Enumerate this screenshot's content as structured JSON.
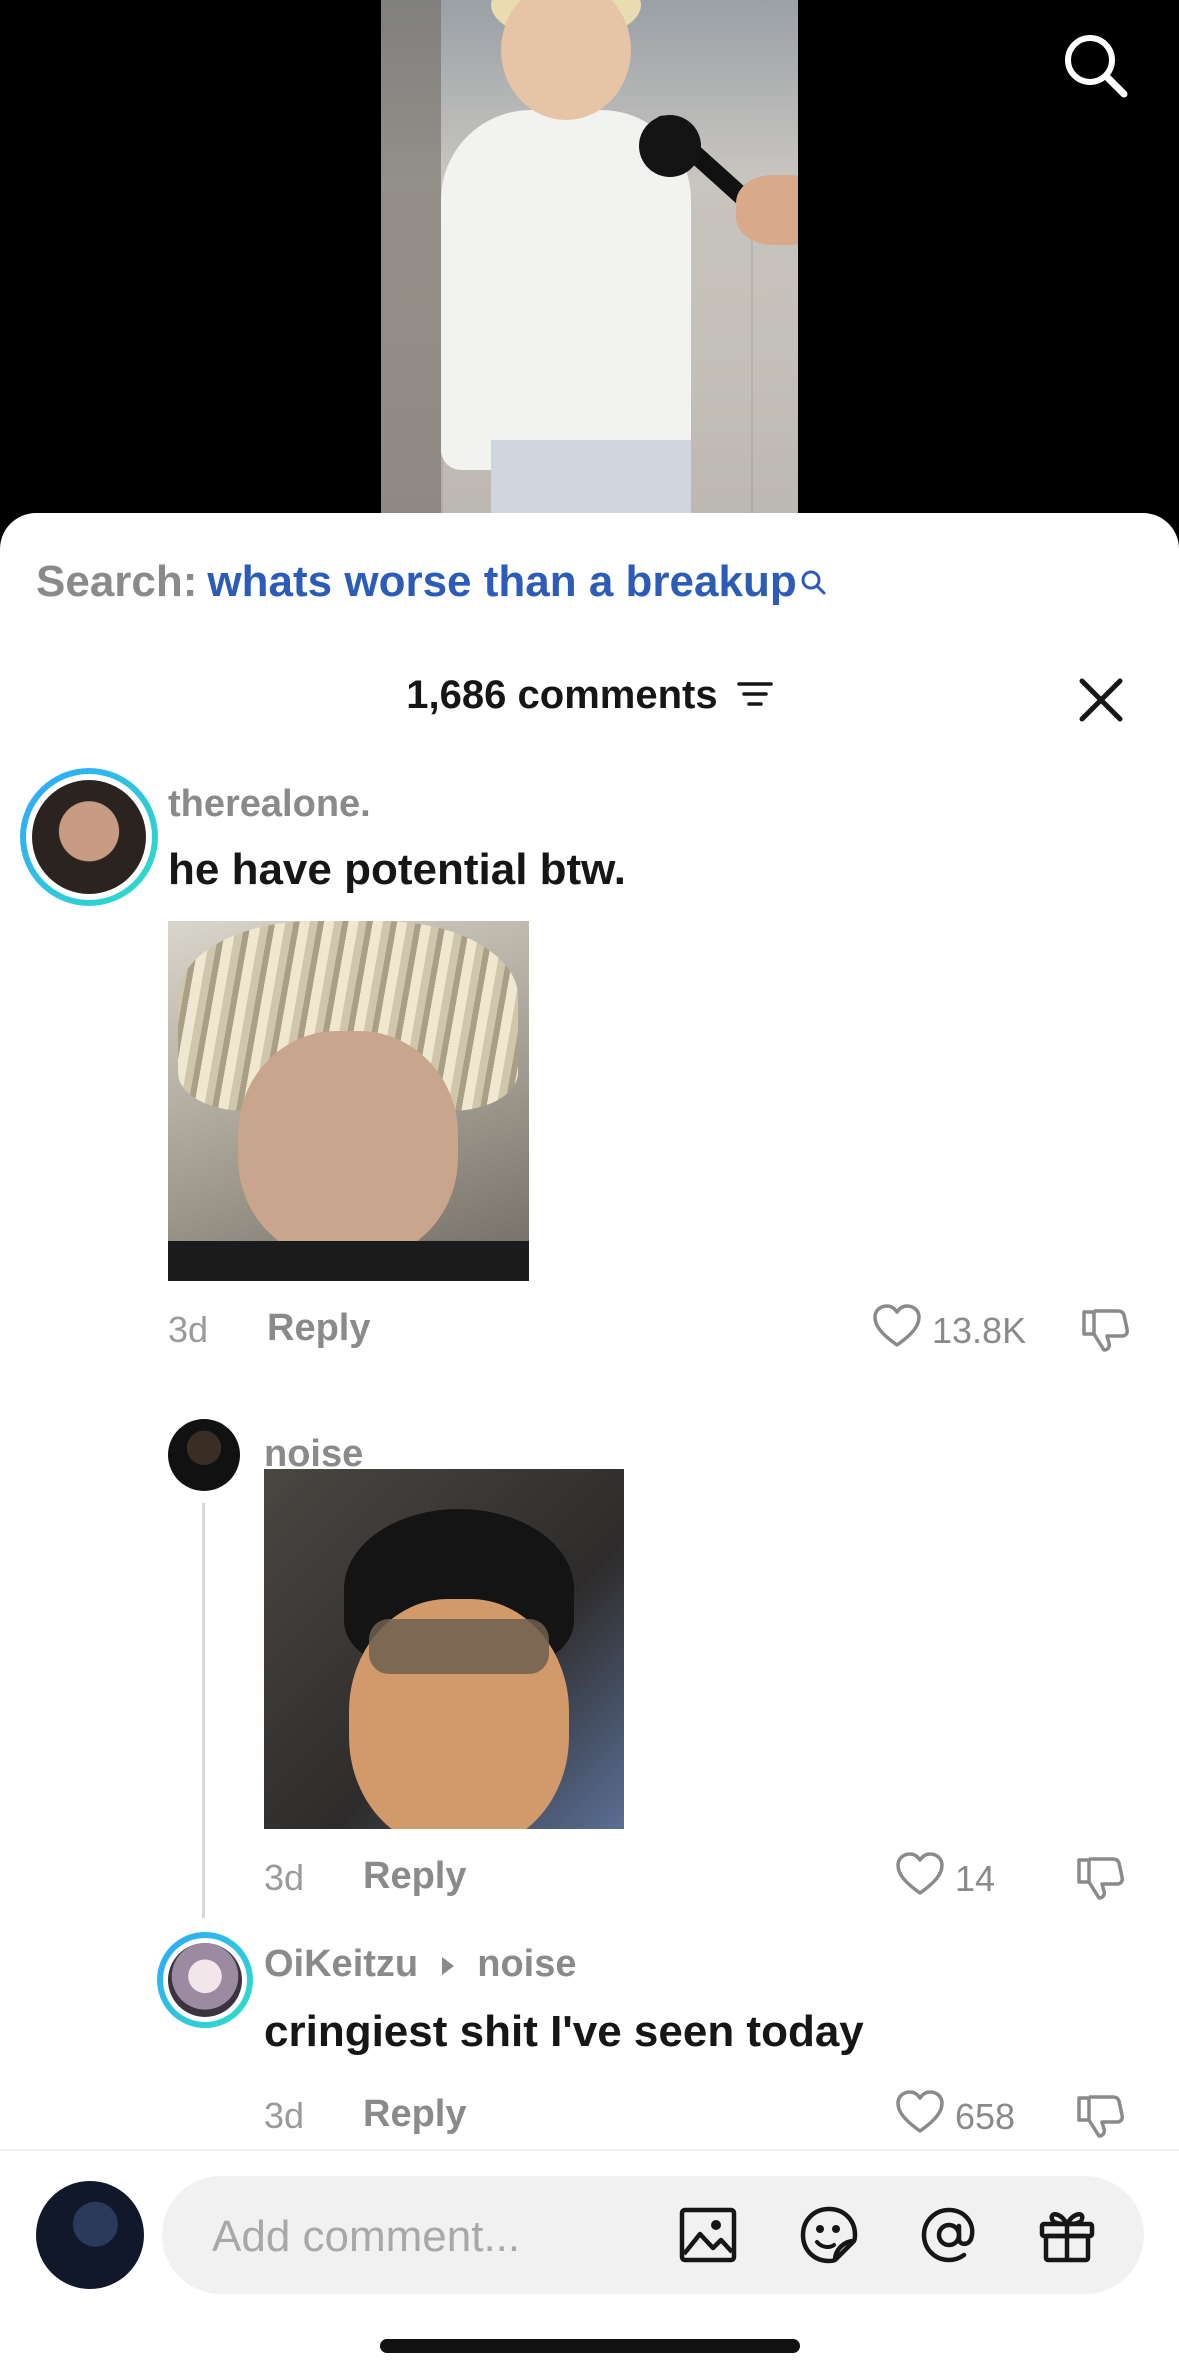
{
  "search_banner": {
    "label": "Search:",
    "query": "whats worse than a breakup"
  },
  "comments_header": {
    "count_label": "1,686 comments"
  },
  "comments": [
    {
      "username": "therealone.",
      "text": "he have potential btw.",
      "age": "3d",
      "reply_label": "Reply",
      "likes": "13.8K"
    },
    {
      "username": "noise",
      "age": "3d",
      "reply_label": "Reply",
      "likes": "14"
    },
    {
      "username": "OiKeitzu",
      "reply_to": "noise",
      "text": "cringiest shit I've seen today",
      "age": "3d",
      "reply_label": "Reply",
      "likes": "658"
    }
  ],
  "composer": {
    "placeholder": "Add comment..."
  },
  "colors": {
    "link_blue": "#2c5bb8",
    "ring_start": "#2ea6ff",
    "ring_end": "#2fe0c5"
  }
}
